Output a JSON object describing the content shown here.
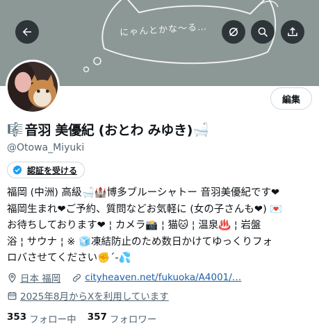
{
  "header": {
    "banner_text": "にゃんとかな〜る…",
    "buttons": [
      {
        "name": "back",
        "icon": "arrow-left-icon"
      },
      {
        "name": "mute",
        "icon": "mute-icon"
      },
      {
        "name": "search",
        "icon": "search-icon"
      },
      {
        "name": "share",
        "icon": "share-icon"
      }
    ]
  },
  "profile": {
    "prefix_icon": "🎼",
    "display_name": "音羽 美優紀 (おとわ みゆき)",
    "suffix_icon": "🛁",
    "handle": "@Otowa_Miyuki",
    "edit_label": "編集",
    "verify_label": "認証を受ける",
    "bio": "福岡 (中洲) 高級🛁🏰博多ブルーシャトー 音羽美優紀です❤\n福岡生まれ❤ご予約、質問などお気軽に (女の子さんも❤) 💌\nお待ちしております❤ ¦ カメラ📸 ¦ 猫🐱 ¦ 温泉♨️ ¦ 岩盤\n浴 ¦ サウナ ¦ ※ 🧊凍結防止のため数日かけてゆっくりフォ\nロバさせてください✊´-💦",
    "location": "日本 福岡",
    "website": "cityheaven.net/fukuoka/A4001/…",
    "joined": "2025年8月からXを利用しています",
    "following_count": "353",
    "following_label": "フォロー中",
    "followers_count": "357",
    "followers_label": "フォロワー"
  },
  "colors": {
    "banner": "#8b9896",
    "text": "#0f1419",
    "secondary": "#536471",
    "link": "#1d5fa8",
    "verify": "#1d9bf0"
  }
}
